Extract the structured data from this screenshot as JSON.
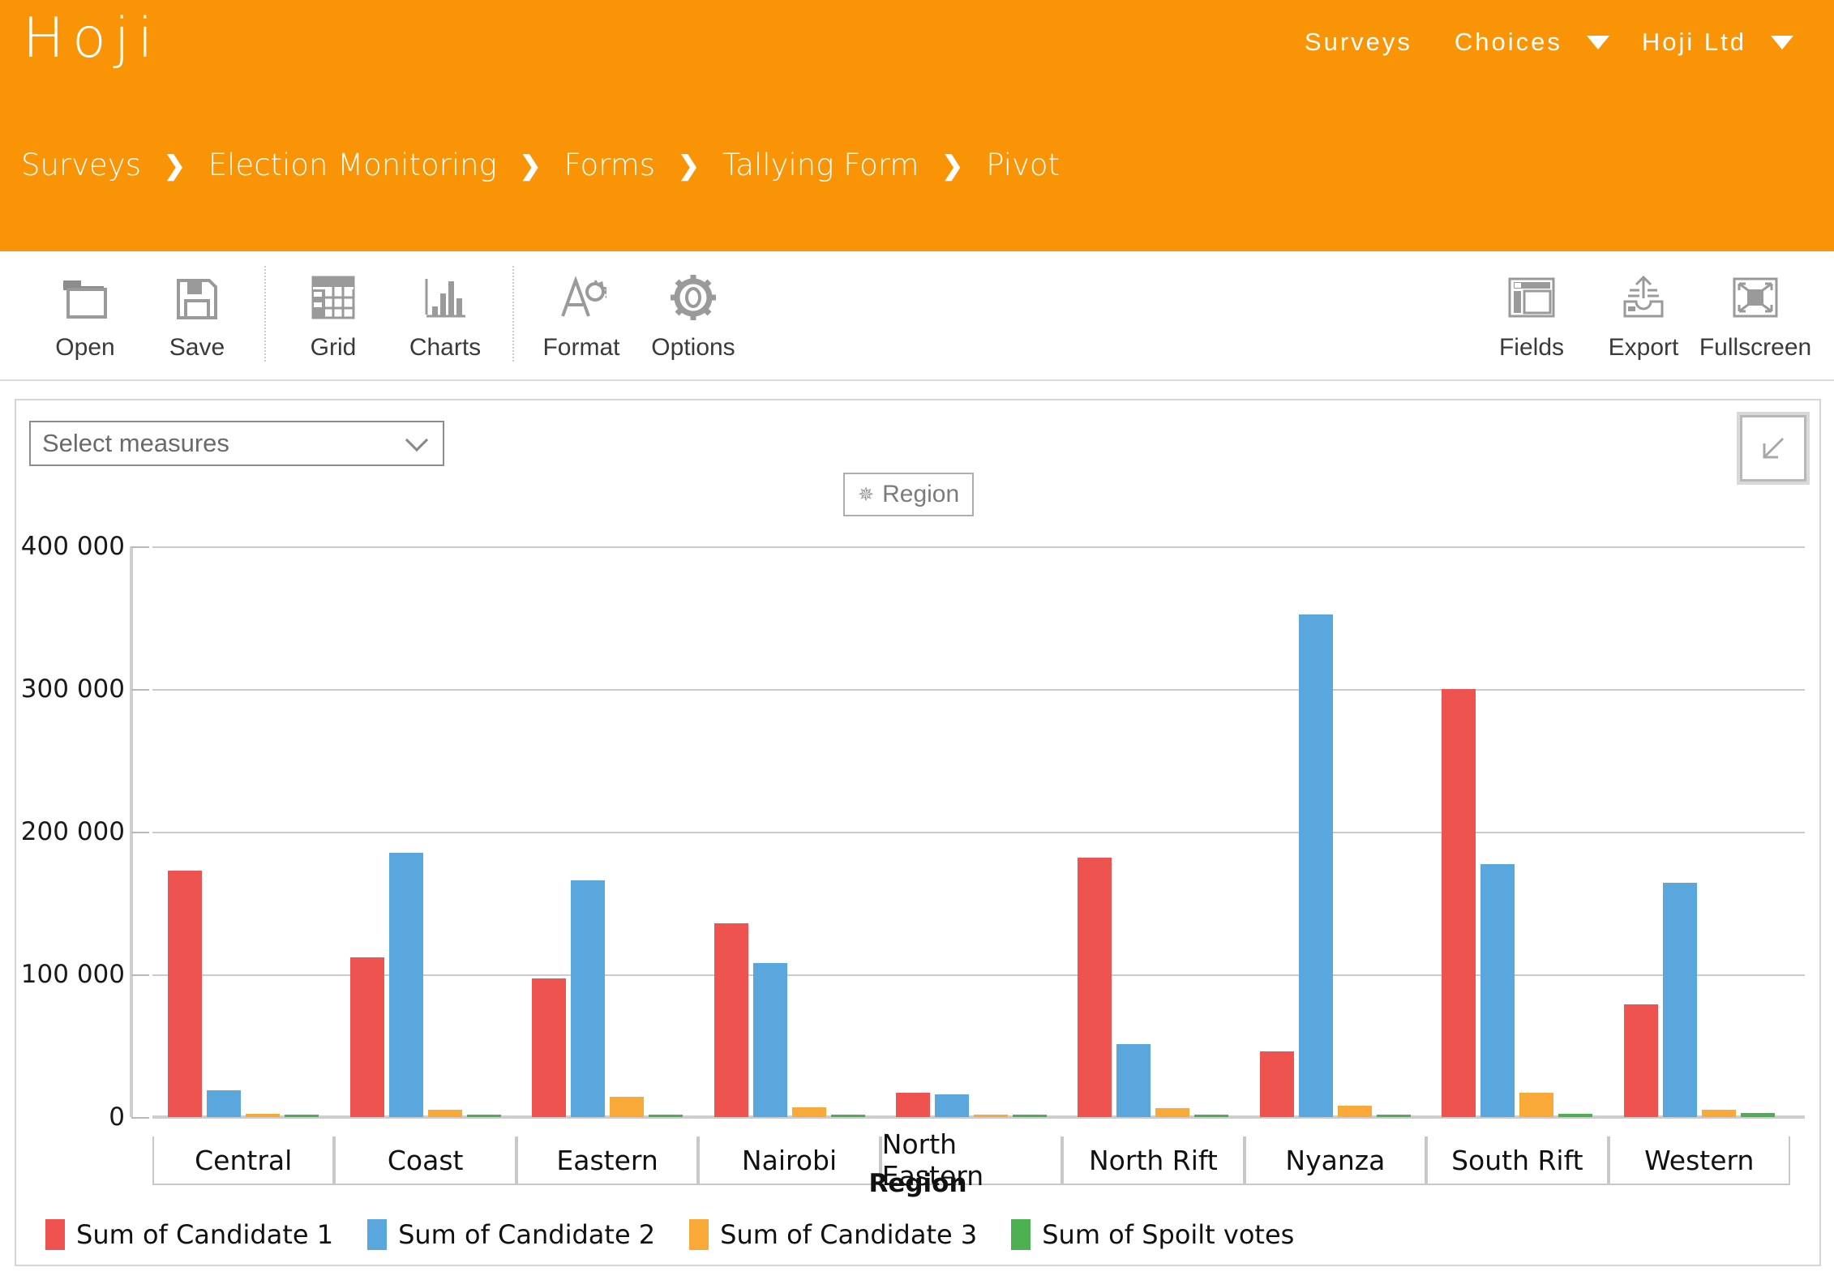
{
  "header": {
    "brand": "Hoji",
    "nav": [
      {
        "label": "Surveys",
        "caret": false
      },
      {
        "label": "Choices",
        "caret": true
      },
      {
        "label": "Hoji Ltd",
        "caret": true
      }
    ],
    "breadcrumb": [
      "Surveys",
      "Election Monitoring",
      "Forms",
      "Tallying Form",
      "Pivot"
    ],
    "separator": "❯",
    "bg_color": "#f89406"
  },
  "toolbar": {
    "left": [
      {
        "label": "Open",
        "icon": "open-folder-icon"
      },
      {
        "label": "Save",
        "icon": "floppy-disk-icon"
      },
      {
        "label": "Grid",
        "icon": "grid-table-icon"
      },
      {
        "label": "Charts",
        "icon": "bar-chart-icon"
      },
      {
        "label": "Format",
        "icon": "format-text-icon"
      },
      {
        "label": "Options",
        "icon": "gear-icon"
      }
    ],
    "right": [
      {
        "label": "Fields",
        "icon": "fields-panel-icon"
      },
      {
        "label": "Export",
        "icon": "export-upload-icon"
      },
      {
        "label": "Fullscreen",
        "icon": "fullscreen-expand-icon"
      }
    ]
  },
  "panel": {
    "measures_placeholder": "Select measures",
    "collapse_icon": "arrow-down-left-icon",
    "field_button": {
      "label": "Region",
      "icon": "gear-small-icon"
    }
  },
  "chart_data": {
    "type": "bar",
    "title": "",
    "xlabel": "Region",
    "ylabel": "",
    "grid": true,
    "legend_position": "bottom-left",
    "ylim": [
      0,
      400000
    ],
    "yticks": [
      0,
      100000,
      200000,
      300000,
      400000
    ],
    "ytick_labels": [
      "0",
      "100 000",
      "200 000",
      "300 000",
      "400 000"
    ],
    "categories": [
      "Central",
      "Coast",
      "Eastern",
      "Nairobi",
      "North Eastern",
      "North Rift",
      "Nyanza",
      "South Rift",
      "Western"
    ],
    "series": [
      {
        "name": "Sum of Candidate 1",
        "color": "#ef5350",
        "values": [
          173000,
          112000,
          97000,
          136000,
          17000,
          182000,
          46000,
          300000,
          79000
        ]
      },
      {
        "name": "Sum of Candidate 2",
        "color": "#5aa7de",
        "values": [
          19000,
          185000,
          166000,
          108000,
          16000,
          51000,
          352000,
          177000,
          164000
        ]
      },
      {
        "name": "Sum of Candidate 3",
        "color": "#f9a938",
        "values": [
          2000,
          5000,
          14000,
          7000,
          1200,
          6000,
          8000,
          17000,
          5000
        ]
      },
      {
        "name": "Sum of Spoilt votes",
        "color": "#4caf50",
        "values": [
          900,
          1000,
          1500,
          600,
          400,
          1100,
          1600,
          2000,
          3000
        ]
      }
    ]
  }
}
